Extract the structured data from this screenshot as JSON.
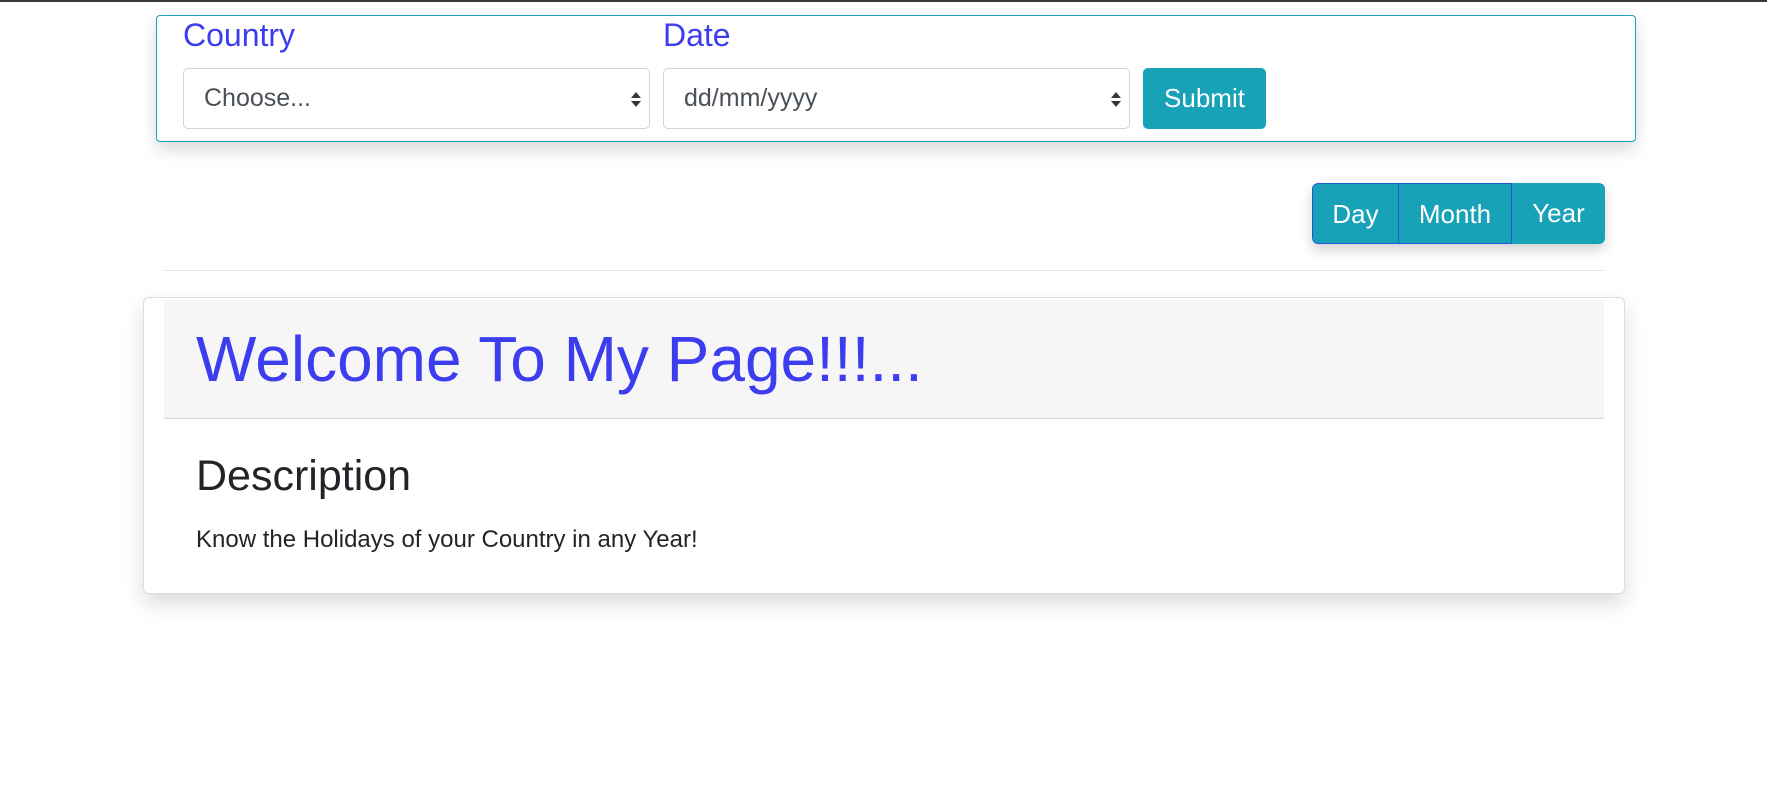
{
  "form": {
    "country_label": "Country",
    "country_value": "Choose...",
    "date_label": "Date",
    "date_value": "dd/mm/yyyy",
    "submit_label": "Submit"
  },
  "period_toggle": {
    "day_label": "Day",
    "month_label": "Month",
    "year_label": "Year"
  },
  "card": {
    "title": "Welcome To My Page!!!...",
    "description_heading": "Description",
    "description_text": "Know the Holidays of your Country in any Year!"
  },
  "colors": {
    "accent": "#17a2b8",
    "heading_blue": "#3d3df0",
    "border_blue": "#1a5ad8",
    "text_dark": "#212529"
  }
}
